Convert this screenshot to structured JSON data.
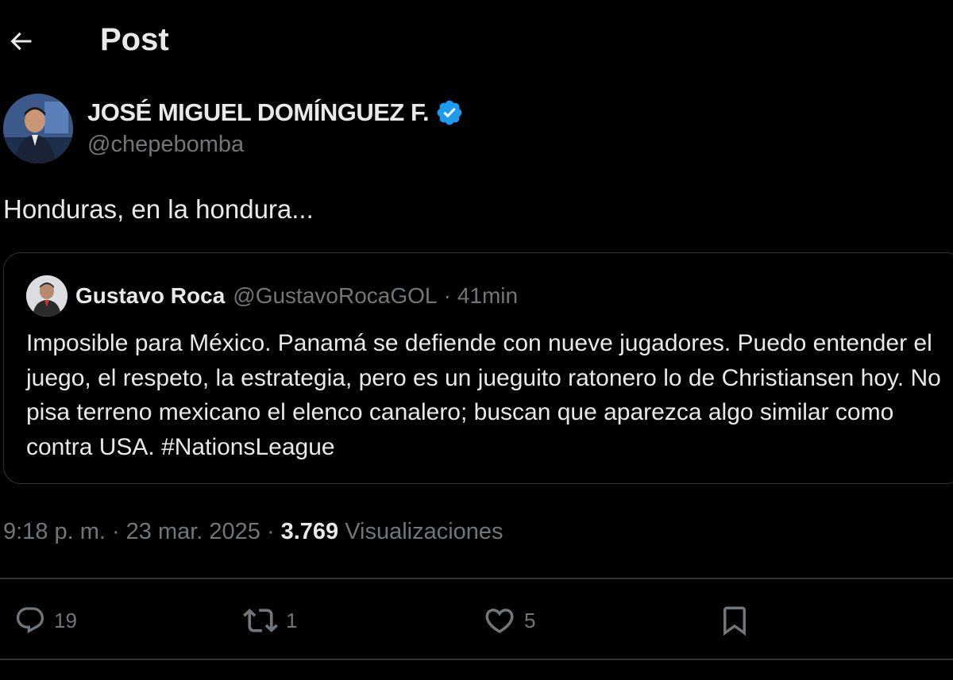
{
  "header": {
    "title": "Post"
  },
  "author": {
    "name": "JOSÉ MIGUEL DOMÍNGUEZ F.",
    "handle": "@chepebomba",
    "verified_icon": "verified-badge-icon",
    "badge_color": "#1d9bf0"
  },
  "tweet": {
    "text": "Honduras, en la hondura..."
  },
  "quote": {
    "name": "Gustavo Roca",
    "handle": "@GustavoRocaGOL",
    "separator": "·",
    "time": "41min",
    "text": "Imposible para México. Panamá se defiende con nueve jugadores. Puedo entender el juego, el respeto, la estrategia, pero es un jueguito ratonero lo de Christiansen hoy. No pisa terreno mexicano el elenco canalero; buscan que aparezca algo similar como contra USA. #NationsLeague"
  },
  "meta": {
    "time": "9:18 p. m.",
    "separator": "·",
    "date": "23 mar. 2025",
    "views_count": "3.769",
    "views_label": "Visualizaciones"
  },
  "actions": {
    "replies": "19",
    "reposts": "1",
    "likes": "5",
    "reply_icon": "reply-icon",
    "repost_icon": "repost-icon",
    "like_icon": "heart-icon",
    "bookmark_icon": "bookmark-icon"
  },
  "colors": {
    "background": "#000000",
    "text_primary": "#e7e9ea",
    "text_secondary": "#71767b",
    "border": "#2f3336",
    "accent": "#1d9bf0"
  }
}
